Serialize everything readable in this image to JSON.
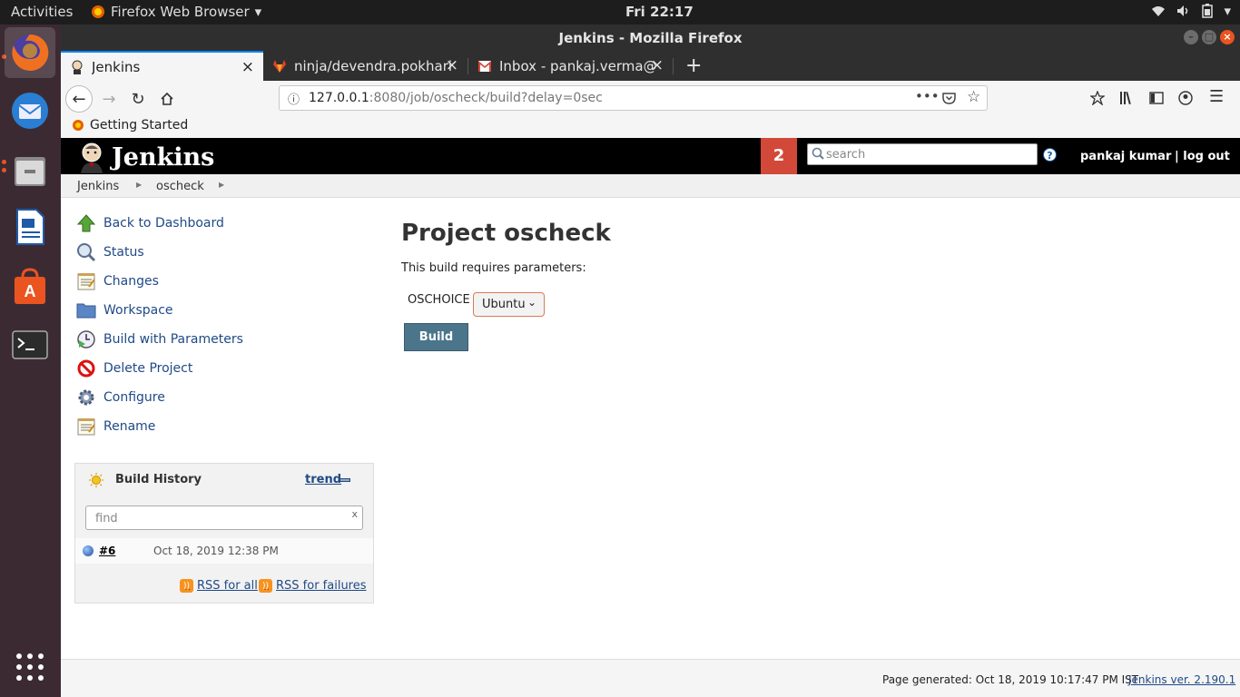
{
  "topbar": {
    "activities": "Activities",
    "app_menu": "Firefox Web Browser",
    "clock": "Fri 22:17"
  },
  "window": {
    "title": "Jenkins - Mozilla Firefox"
  },
  "tabs": [
    {
      "label": "Jenkins",
      "active": true
    },
    {
      "label": "ninja/devendra.pokhariya",
      "active": false
    },
    {
      "label": "Inbox - pankaj.verma@m",
      "active": false
    }
  ],
  "navbar": {
    "url_host": "127.0.0.1",
    "url_rest": ":8080/job/oscheck/build?delay=0sec"
  },
  "bookmarks": {
    "getting_started": "Getting Started"
  },
  "jenkins": {
    "logo_text": "Jenkins",
    "notification_count": "2",
    "search_placeholder": "search",
    "help": "?",
    "user": "pankaj kumar",
    "logout": "| log out"
  },
  "breadcrumbs": [
    "Jenkins",
    "oscheck"
  ],
  "side_tasks": [
    {
      "label": "Back to Dashboard",
      "icon": "up-arrow-icon"
    },
    {
      "label": "Status",
      "icon": "magnifier-icon"
    },
    {
      "label": "Changes",
      "icon": "notepad-icon"
    },
    {
      "label": "Workspace",
      "icon": "folder-icon"
    },
    {
      "label": "Build with Parameters",
      "icon": "clock-play-icon"
    },
    {
      "label": "Delete Project",
      "icon": "no-entry-icon"
    },
    {
      "label": "Configure",
      "icon": "gear-icon"
    },
    {
      "label": "Rename",
      "icon": "notepad-icon"
    }
  ],
  "build_history": {
    "title": "Build History",
    "trend": "trend",
    "find_placeholder": "find",
    "clear": "x",
    "builds": [
      {
        "number": "#6",
        "date": "Oct 18, 2019 12:38 PM"
      }
    ],
    "rss_all": "RSS for all",
    "rss_failures": "RSS for failures"
  },
  "main": {
    "title": "Project oscheck",
    "requires": "This build requires parameters:",
    "param_name": "OSCHOICE",
    "param_value": "Ubuntu",
    "build_button": "Build"
  },
  "footer": {
    "generated": "Page generated: Oct 18, 2019 10:17:47 PM IST",
    "version": "Jenkins ver. 2.190.1"
  },
  "colors": {
    "jenkins_header": "#000000",
    "notification": "#d24939",
    "build_button": "#4b758b",
    "link": "#204a87",
    "dock": "#3c2a33",
    "accent": "#e95420"
  }
}
